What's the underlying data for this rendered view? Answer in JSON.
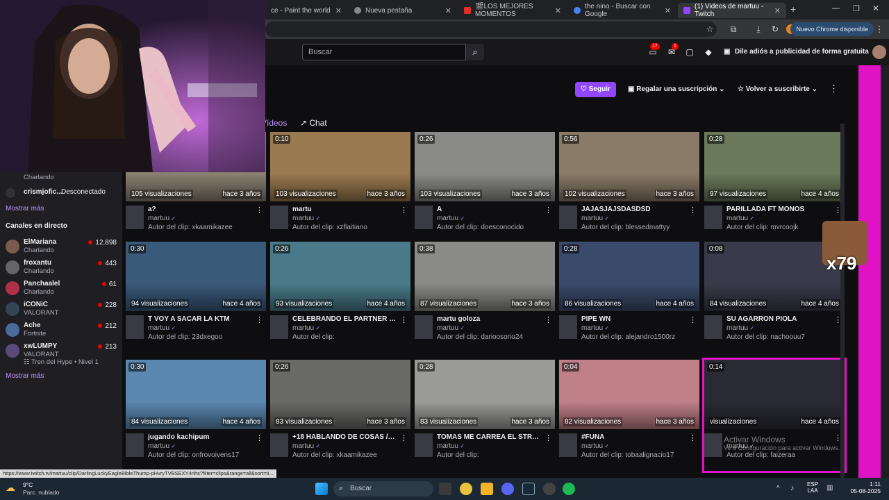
{
  "browser": {
    "tabs": [
      {
        "title": "ce - Paint the world",
        "active": false
      },
      {
        "title": "Nueva pestaña",
        "active": false
      },
      {
        "title": "🎬LOS MEJORES MOMENTOS",
        "active": false
      },
      {
        "title": "the nino - Buscar con Google",
        "active": false
      },
      {
        "title": "(1) Videos de martuu - Twitch",
        "active": true
      }
    ],
    "new_tab": "+",
    "update_label": "Nuevo Chrome disponible",
    "status_url": "https://www.twitch.tv/martuu/clip/DarlingLuckyEagleBibleThump-pHvryTVBSEXY4nhs?filter=clips&range=all&sort=ti..."
  },
  "topnav": {
    "search_placeholder": "Buscar",
    "notifications_count": "17",
    "inbox_count": "1",
    "ad_free_label": "Dile adiós a publicidad de forma gratuita"
  },
  "channel_actions": {
    "follow_label": "Seguir",
    "gift_label": "Regalar una suscripción",
    "resub_label": "Volver a suscribirte"
  },
  "channel_tabs": {
    "videos": "Vídeos",
    "chat": "Chat"
  },
  "sidebar": {
    "top_rows": [
      {
        "name": "",
        "game": "Charlando"
      },
      {
        "name": "crismjofic...",
        "game": "Desconectado"
      }
    ],
    "show_more_1": "Mostrar más",
    "live_header": "Canales en directo",
    "live": [
      {
        "name": "ElMariana",
        "game": "Charlando",
        "viewers": "12.898",
        "color": "#7a5a4a"
      },
      {
        "name": "froxantu",
        "game": "Charlando",
        "viewers": "443",
        "color": "#666666"
      },
      {
        "name": "Panchaalel",
        "game": "Charlando",
        "viewers": "61",
        "color": "#b0304a"
      },
      {
        "name": "iCONiC",
        "game": "VALORANT",
        "viewers": "228",
        "color": "#334455"
      },
      {
        "name": "Ache",
        "game": "Fortnite",
        "viewers": "212",
        "color": "#4a6a9a"
      },
      {
        "name": "xwLUMPY",
        "game": "VALORANT",
        "viewers": "213",
        "color": "#5a4a7a",
        "extra": "Tren del Hype • Nivel 1"
      }
    ],
    "show_more_2": "Mostrar más"
  },
  "clips": [
    {
      "views": "105 visualizaciones",
      "ago": "hace 3 años",
      "title": "a?",
      "channel": "martuu",
      "author": "Autor del clip: xkaamikazee",
      "color": "#8a8070",
      "duration": ""
    },
    {
      "views": "103 visualizaciones",
      "ago": "hace 3 años",
      "title": "martu",
      "channel": "martuu",
      "author": "Autor del clip: xzflaitiano",
      "color": "#9a7a50",
      "duration": "0:10"
    },
    {
      "views": "103 visualizaciones",
      "ago": "hace 3 años",
      "title": "A",
      "channel": "martuu",
      "author": "Autor del clip: doesconocido",
      "color": "#8a8a88",
      "duration": "0:26"
    },
    {
      "views": "102 visualizaciones",
      "ago": "hace 3 años",
      "title": "JAJASJAJSDASDSD",
      "channel": "martuu",
      "author": "Autor del clip: blessedmattyy",
      "color": "#8a7a68",
      "duration": "0:56"
    },
    {
      "views": "97 visualizaciones",
      "ago": "hace 4 años",
      "title": "PARILLADA FT MONOS",
      "channel": "martuu",
      "author": "Autor del clip: mvrcoojk",
      "color": "#6a7a5a",
      "duration": "0:28"
    },
    {
      "views": "94 visualizaciones",
      "ago": "hace 4 años",
      "title": "T VOY A SACAR LA KTM",
      "channel": "martuu",
      "author": "Autor del clip: 23dxegoo",
      "color": "#3a5a7a",
      "duration": "0:30"
    },
    {
      "views": "93 visualizaciones",
      "ago": "hace 4 años",
      "title": "CELEBRANDO EL PARTNER CON...",
      "channel": "martuu",
      "author": "Autor del clip:",
      "color": "#4a7a8a",
      "duration": "0:26"
    },
    {
      "views": "87 visualizaciones",
      "ago": "hace 3 años",
      "title": "martu goloza",
      "channel": "martuu",
      "author": "Autor del clip: darioosorio24",
      "color": "#8a8a88",
      "duration": "0:38"
    },
    {
      "views": "86 visualizaciones",
      "ago": "hace 4 años",
      "title": "PIPE WN",
      "channel": "martuu",
      "author": "Autor del clip: alejandro1500rz",
      "color": "#3a4a6a",
      "duration": "0:28"
    },
    {
      "views": "84 visualizaciones",
      "ago": "hace 4 años",
      "title": "SU AGARRON PIOLA",
      "channel": "martuu",
      "author": "Autor del clip: nachoouu7",
      "color": "#3a3a4a",
      "duration": "0:08"
    },
    {
      "views": "84 visualizaciones",
      "ago": "hace 4 años",
      "title": "jugando kachipum",
      "channel": "martuu",
      "author": "Autor del clip: onfrovoivens17",
      "color": "#5a88b0",
      "duration": "0:30"
    },
    {
      "views": "83 visualizaciones",
      "ago": "hace 3 años",
      "title": "+18 HABLANDO DE COSAS // !ig...",
      "channel": "martuu",
      "author": "Autor del clip: xkaamikazee",
      "color": "#6a6a68",
      "duration": "0:26"
    },
    {
      "views": "83 visualizaciones",
      "ago": "hace 3 años",
      "title": "TOMAS ME CARREA EL STREA...",
      "channel": "martuu",
      "author": "Autor del clip:",
      "color": "#9a9a98",
      "duration": "0:28"
    },
    {
      "views": "82 visualizaciones",
      "ago": "hace 3 años",
      "title": "#FUNA",
      "channel": "martuu",
      "author": "Autor del clip: tobaalignacio17",
      "color": "#c08088",
      "duration": "0:04"
    },
    {
      "views": "visualizaciones",
      "ago": "hace 4 años",
      "title": "",
      "channel": "martuu",
      "author": "Autor del clip: faizeraa",
      "color": "#2a2a34",
      "duration": "0:14"
    }
  ],
  "emote_text": "x79",
  "watermark": {
    "line1": "Activar Windows",
    "line2": "Ve a Configuración para activar Windows."
  },
  "taskbar": {
    "weather_temp": "9°C",
    "weather_desc": "Parc. nublado",
    "search_label": "Buscar",
    "lang": "ESP",
    "lang2": "LAA",
    "time": "1:11",
    "date": "05-08-2025"
  }
}
